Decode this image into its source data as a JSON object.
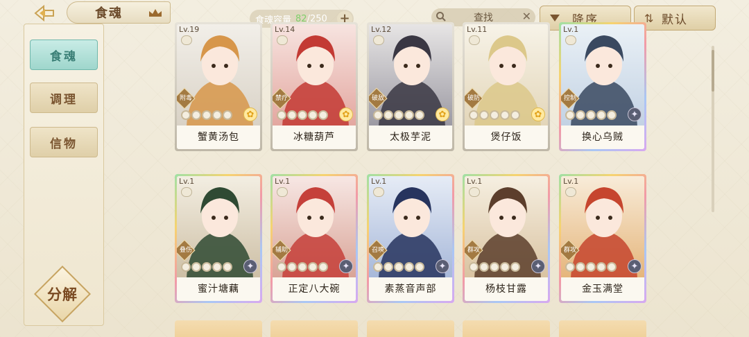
{
  "header": {
    "title": "食魂",
    "capacity_label": "食魂容量",
    "capacity_current": "82",
    "capacity_total": "/250",
    "search_label": "查找",
    "sort_label": "降序",
    "default_label": "默认"
  },
  "sidebar": {
    "tabs": [
      {
        "label": "食魂"
      },
      {
        "label": "调理"
      },
      {
        "label": "信物"
      }
    ],
    "decompose_label": "分解"
  },
  "cards": [
    {
      "level": "Lv.19",
      "role": "附毒",
      "name": "蟹黄汤包",
      "badge": "flower",
      "filled_stars": 0,
      "frame": "gold",
      "bg": [
        "#f2efe9",
        "#d9d2c6"
      ],
      "accent": "#d7964a"
    },
    {
      "level": "Lv.14",
      "role": "禁疗",
      "name": "冰糖葫芦",
      "badge": "flower",
      "filled_stars": 0,
      "frame": "gold",
      "bg": [
        "#f7e4e0",
        "#e3a7a0"
      ],
      "accent": "#c33a34"
    },
    {
      "level": "Lv.12",
      "role": "破敌",
      "name": "太极芋泥",
      "badge": "flower",
      "filled_stars": 0,
      "frame": "gold",
      "bg": [
        "#e7e5e5",
        "#9c9aa3"
      ],
      "accent": "#3a3743"
    },
    {
      "level": "Lv.11",
      "role": "破防",
      "name": "煲仔饭",
      "badge": "flower",
      "filled_stars": 0,
      "frame": "gold",
      "bg": [
        "#f7f3e8",
        "#e3d6b9"
      ],
      "accent": "#dcc88a"
    },
    {
      "level": "Lv.1",
      "role": "控制",
      "name": "换心乌贼",
      "badge": "dark",
      "filled_stars": 0,
      "frame": "rainbow",
      "bg": [
        "#eaf1f6",
        "#c3d2e4"
      ],
      "accent": "#3a4960"
    },
    {
      "level": "Lv.1",
      "role": "叠伤",
      "name": "蜜汁塘藕",
      "badge": "dark",
      "filled_stars": 0,
      "frame": "rainbow",
      "bg": [
        "#f3eee2",
        "#cdbfa5"
      ],
      "accent": "#2f4a33"
    },
    {
      "level": "Lv.1",
      "role": "辅助",
      "name": "正定八大碗",
      "badge": "dark",
      "filled_stars": 0,
      "frame": "rainbow",
      "bg": [
        "#f7e7e4",
        "#d9a497"
      ],
      "accent": "#c5403a"
    },
    {
      "level": "Lv.1",
      "role": "召唤",
      "name": "素蒸音声部",
      "badge": "dark",
      "filled_stars": 0,
      "frame": "rainbow",
      "bg": [
        "#e6ecf6",
        "#a7b8d9"
      ],
      "accent": "#27345e"
    },
    {
      "level": "Lv.1",
      "role": "群攻",
      "name": "杨枝甘露",
      "badge": "dark",
      "filled_stars": 0,
      "frame": "rainbow",
      "bg": [
        "#f6efe1",
        "#d9c3a1"
      ],
      "accent": "#5c3e2c"
    },
    {
      "level": "Lv.1",
      "role": "群攻",
      "name": "金玉满堂",
      "badge": "dark",
      "filled_stars": 0,
      "frame": "rainbow",
      "bg": [
        "#f8ecd9",
        "#e5b57b"
      ],
      "accent": "#c6452e"
    }
  ],
  "colors": {
    "active_tab": "#9fd6cc",
    "text_brown": "#6b4a2a",
    "capacity_green": "#7fcf6a"
  }
}
